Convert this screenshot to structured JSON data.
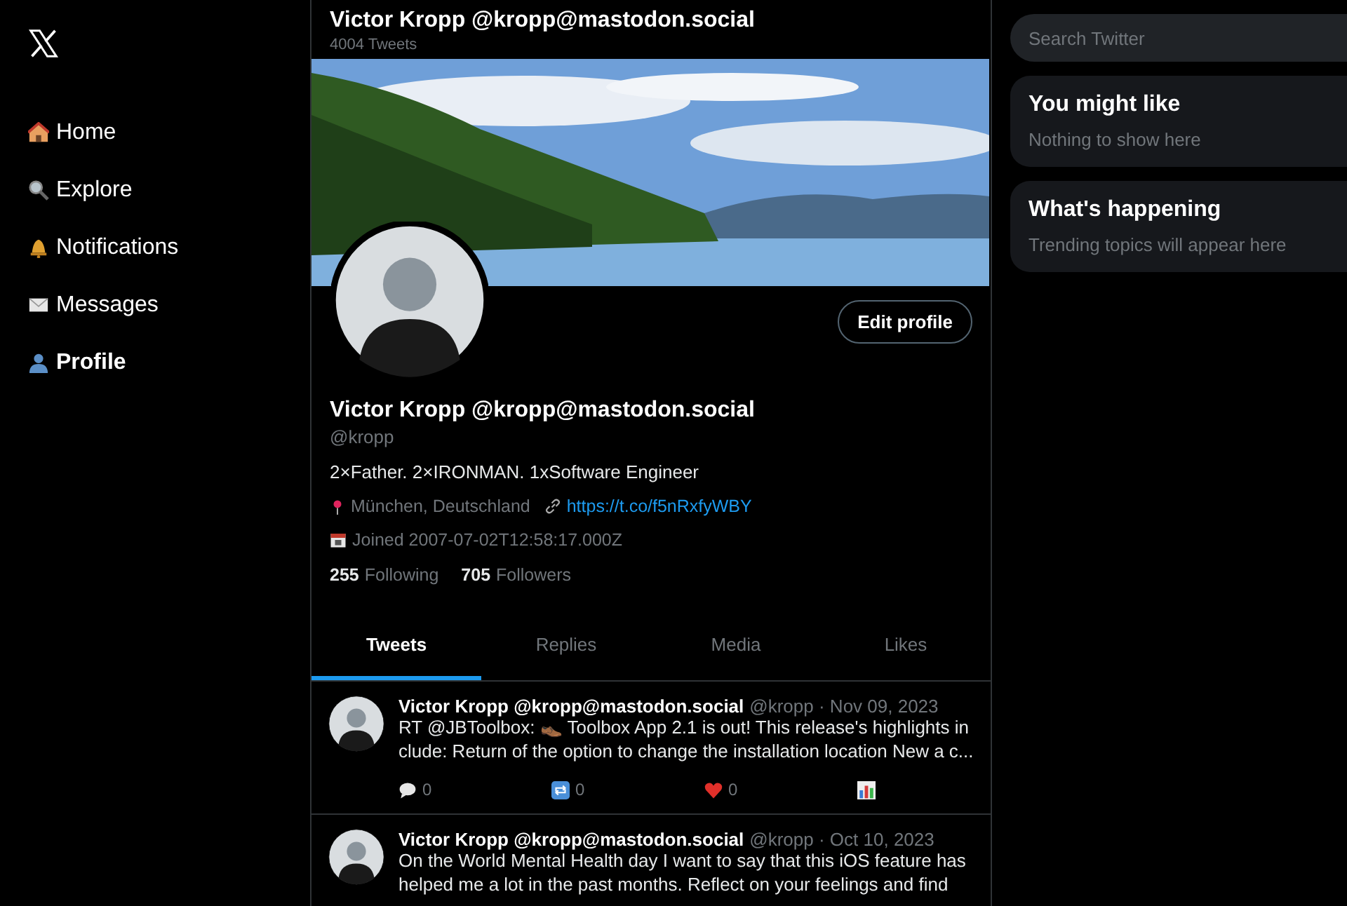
{
  "sidebar": {
    "items": [
      {
        "label": "Home",
        "selected": false
      },
      {
        "label": "Explore",
        "selected": false
      },
      {
        "label": "Notifications",
        "selected": false
      },
      {
        "label": "Messages",
        "selected": false
      },
      {
        "label": "Profile",
        "selected": true
      }
    ]
  },
  "header": {
    "title": "Victor Kropp @kropp@mastodon.social",
    "count": "4004 Tweets"
  },
  "profile": {
    "edit_button": "Edit profile",
    "name": "Victor Kropp @kropp@mastodon.social",
    "handle": "@kropp",
    "bio": "2×Father. 2×IRONMAN. 1xSoftware Engineer",
    "location": "München, Deutschland",
    "link": "https://t.co/f5nRxfyWBY",
    "joined": "Joined 2007-07-02T12:58:17.000Z",
    "following_count": "255",
    "following_label": "Following",
    "followers_count": "705",
    "followers_label": "Followers"
  },
  "tabs": [
    {
      "label": "Tweets",
      "selected": true
    },
    {
      "label": "Replies",
      "selected": false
    },
    {
      "label": "Media",
      "selected": false
    },
    {
      "label": "Likes",
      "selected": false
    }
  ],
  "tweets": [
    {
      "name": "Victor Kropp @kropp@mastodon.social",
      "meta": "@kropp · Nov 09, 2023",
      "text": "RT @JBToolbox: 👞 Toolbox App 2.1 is out! This release's highlights in clude: Return of the option to change the installation location New a c...",
      "actions": {
        "replies": "0",
        "retweets": "0",
        "likes": "0"
      }
    },
    {
      "name": "Victor Kropp @kropp@mastodon.social",
      "meta": "@kropp · Oct 10, 2023",
      "text": "On the World Mental Health day I want to say that this iOS feature has helped me a lot in the past months. Reflect on your feelings and find"
    }
  ],
  "search": {
    "placeholder": "Search Twitter"
  },
  "cards": [
    {
      "title": "You might like",
      "text": "Nothing to show here"
    },
    {
      "title": "What's happening",
      "text": "Trending topics will appear here"
    }
  ]
}
